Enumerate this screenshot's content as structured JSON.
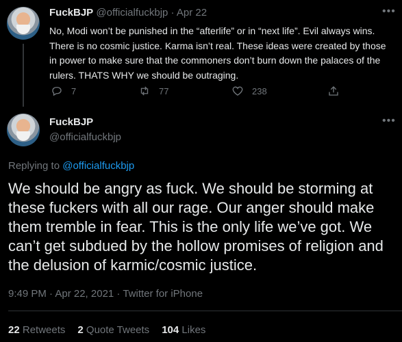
{
  "tweet1": {
    "name": "FuckBJP",
    "handle": "@officialfuckbjp",
    "separator": "·",
    "date": "Apr 22",
    "text": "No, Modi won’t be punished in the “afterlife” or in “next life”. Evil always wins. There is no cosmic justice. Karma isn’t real. These ideas were created by those in power to make sure that the commoners don’t burn down the palaces of the rulers. THATS WHY we should be outraging.",
    "replies": "7",
    "retweets": "77",
    "likes": "238"
  },
  "tweet2": {
    "name": "FuckBJP",
    "handle": "@officialfuckbjp",
    "replying_prefix": "Replying to ",
    "replying_handle": "@officialfuckbjp",
    "text": "We should be angry as fuck. We should be storming at these fuckers with all our rage. Our anger should make them tremble in fear. This is the only life we’ve got. We can’t get subdued by the hollow promises of religion and the delusion of karmic/cosmic justice.",
    "meta": "9:49 PM · Apr 22, 2021 · Twitter for iPhone",
    "retweets_count": "22",
    "retweets_label": "Retweets",
    "quotes_count": "2",
    "quotes_label": "Quote Tweets",
    "likes_count": "104",
    "likes_label": "Likes"
  },
  "icons": {
    "more": "more-icon",
    "reply": "reply-icon",
    "retweet": "retweet-icon",
    "like": "heart-icon",
    "share": "share-icon"
  }
}
